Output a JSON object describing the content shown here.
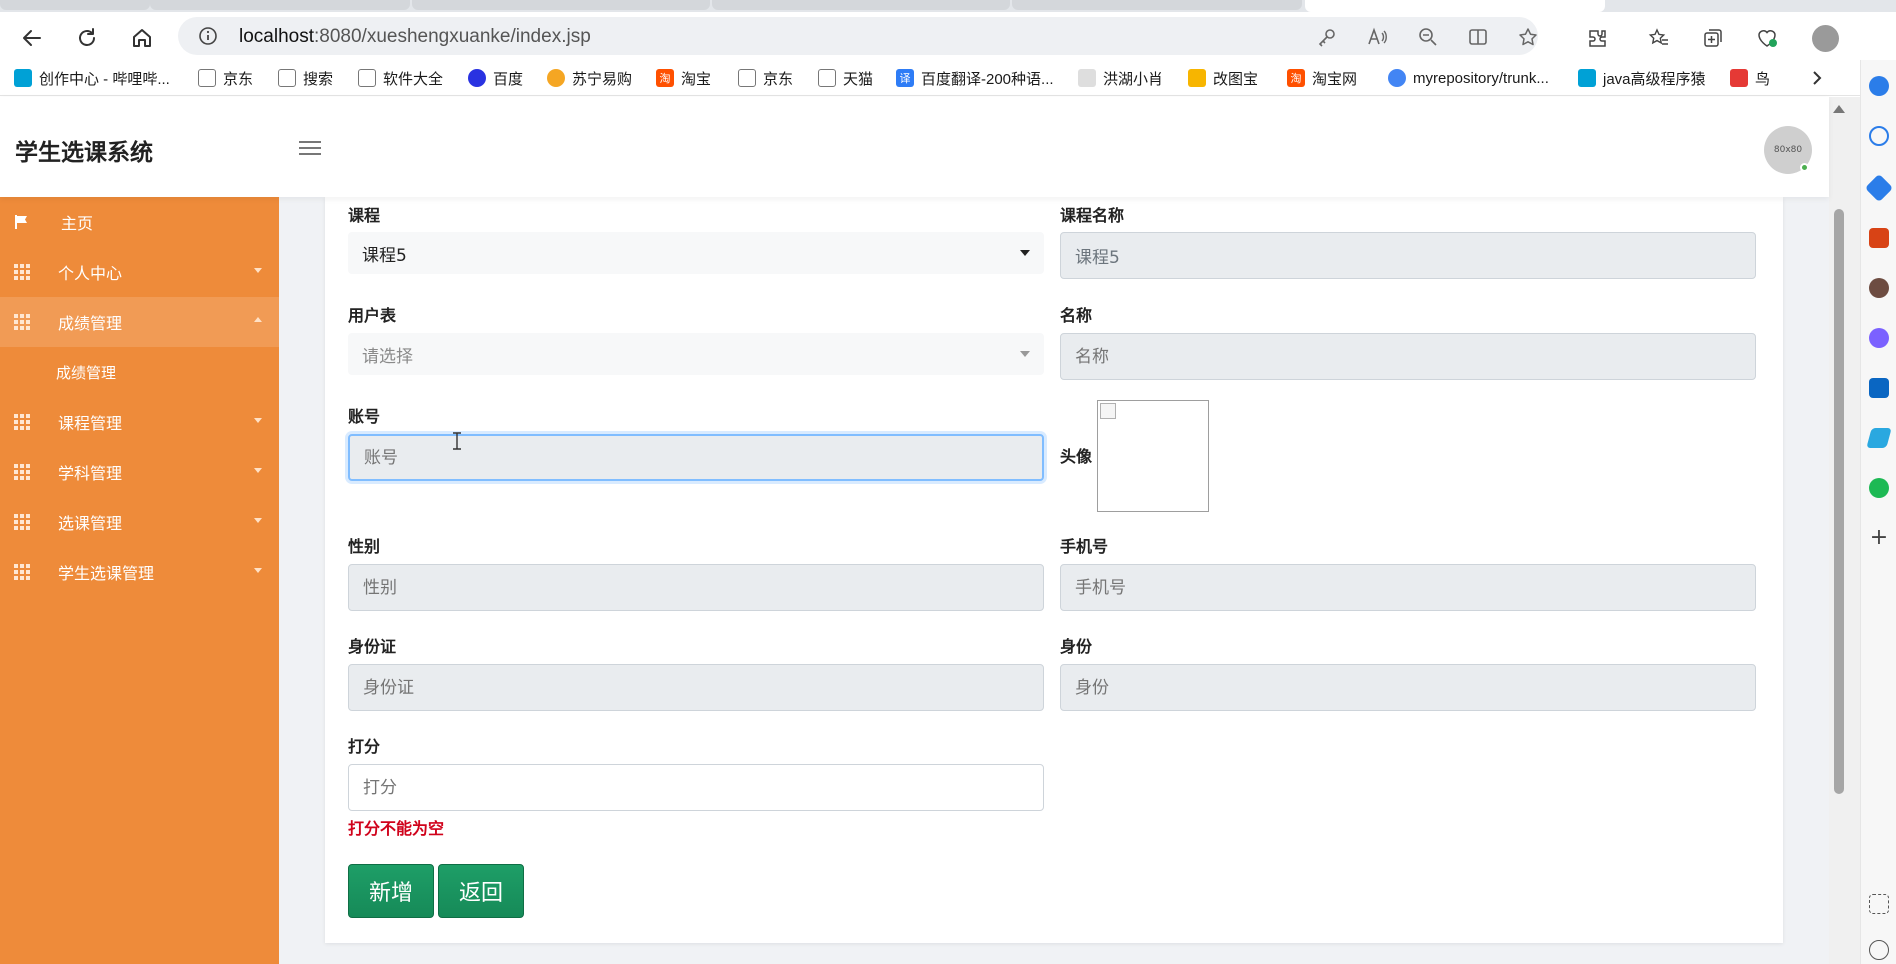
{
  "browser": {
    "url_host": "localhost",
    "url_rest": ":8080/xueshengxuanke/index.jsp"
  },
  "bookmarks": [
    {
      "label": "创作中心 - 哔哩哔...",
      "color": "#00a1d6"
    },
    {
      "label": "京东",
      "color": "#888888"
    },
    {
      "label": "搜索",
      "color": "#888888"
    },
    {
      "label": "软件大全",
      "color": "#888888"
    },
    {
      "label": "百度",
      "color": "#2932e1"
    },
    {
      "label": "苏宁易购",
      "color": "#f5a623"
    },
    {
      "label": "淘宝",
      "color": "#ff5000"
    },
    {
      "label": "京东",
      "color": "#888888"
    },
    {
      "label": "天猫",
      "color": "#888888"
    },
    {
      "label": "百度翻译-200种语...",
      "color": "#2e7cf6"
    },
    {
      "label": "洪湖小肖",
      "color": "#666666"
    },
    {
      "label": "改图宝",
      "color": "#f7b500"
    },
    {
      "label": "淘宝网",
      "color": "#ff5000"
    },
    {
      "label": "myrepository/trunk...",
      "color": "#4285f4"
    },
    {
      "label": "java高级程序猿",
      "color": "#00a1d6"
    },
    {
      "label": "鸟",
      "color": "#e53935"
    }
  ],
  "app": {
    "title": "学生选课系统",
    "avatar_text": "80x80"
  },
  "sidebar": {
    "items": [
      {
        "label": "主页"
      },
      {
        "label": "个人中心"
      },
      {
        "label": "成绩管理"
      },
      {
        "label": "成绩管理"
      },
      {
        "label": "课程管理"
      },
      {
        "label": "学科管理"
      },
      {
        "label": "选课管理"
      },
      {
        "label": "学生选课管理"
      }
    ]
  },
  "form": {
    "course_label": "课程",
    "course_value": "课程5",
    "course_name_label": "课程名称",
    "course_name_value": "课程5",
    "user_table_label": "用户表",
    "user_table_placeholder": "请选择",
    "name_label": "名称",
    "name_placeholder": "名称",
    "account_label": "账号",
    "account_placeholder": "账号",
    "avatar_label": "头像",
    "gender_label": "性别",
    "gender_placeholder": "性别",
    "phone_label": "手机号",
    "phone_placeholder": "手机号",
    "idcard_label": "身份证",
    "idcard_placeholder": "身份证",
    "identity_label": "身份",
    "identity_placeholder": "身份",
    "score_label": "打分",
    "score_placeholder": "打分",
    "score_error": "打分不能为空",
    "add_button": "新增",
    "back_button": "返回"
  },
  "colors": {
    "sidebar": "#ee8b3a",
    "button": "#1e9e67",
    "error": "#d0021b"
  }
}
